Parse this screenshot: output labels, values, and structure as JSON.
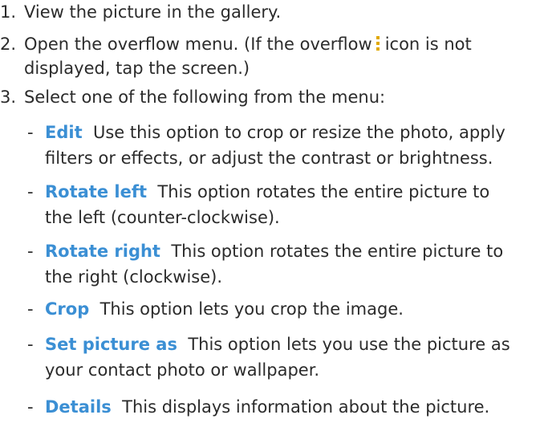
{
  "steps": [
    {
      "number": "1.",
      "text": "View the picture in the gallery."
    },
    {
      "number": "2.",
      "text_before_icon": "Open the overflow menu. (If the  overflow",
      "text_after_icon": "icon is not",
      "continuation": "displayed, tap the screen.)",
      "icon": "overflow-menu-icon"
    },
    {
      "number": "3.",
      "text": "Select one of the following from the menu:"
    }
  ],
  "options": [
    {
      "dash": "-",
      "keyword": "Edit",
      "description": "Use this option to crop or resize the photo, apply",
      "continuation": "filters or effects, or adjust the contrast or brightness."
    },
    {
      "dash": "-",
      "keyword": "Rotate left",
      "description": "This option rotates the entire picture to",
      "continuation": "the left (counter-clockwise)."
    },
    {
      "dash": "-",
      "keyword": "Rotate right",
      "description": "This option rotates the entire picture to",
      "continuation": "the right (clockwise)."
    },
    {
      "dash": "-",
      "keyword": "Crop",
      "description": "This option lets you crop the image."
    },
    {
      "dash": "-",
      "keyword": "Set picture as",
      "description": "This option lets you use the picture as",
      "continuation": "your contact photo or wallpaper."
    },
    {
      "dash": "-",
      "keyword": "Details",
      "description": "This displays information about the picture."
    }
  ],
  "colors": {
    "keyword": "#3b8fd4",
    "text": "#2b2b2b",
    "icon": "#e0a800"
  }
}
